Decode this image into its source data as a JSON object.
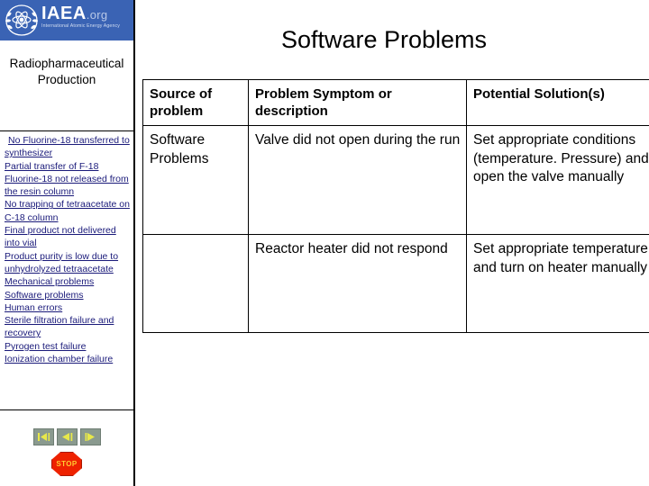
{
  "sidebar": {
    "logo": {
      "emblem_icon": "iaea-atom-laurel-icon",
      "main": "IAEA",
      "org": ".org",
      "subtitle": "International Atomic Energy Agency"
    },
    "title": "Radiopharmaceutical Production",
    "links": [
      "No Fluorine-18 transferred to synthesizer",
      "Partial transfer of F-18",
      "Fluorine-18 not released from the resin column",
      "No trapping of tetraacetate on C-18 column",
      "Final product not delivered into vial",
      "Product purity is low due to unhydrolyzed tetraacetate",
      "Mechanical problems",
      "Software problems",
      "Human errors",
      "Sterile filtration failure and recovery",
      "Pyrogen test failure",
      "Ionization chamber failure"
    ],
    "nav_buttons": [
      {
        "name": "first-slide-button",
        "icon": "first-slide-icon"
      },
      {
        "name": "previous-slide-button",
        "icon": "previous-slide-icon"
      },
      {
        "name": "next-slide-button",
        "icon": "next-slide-icon"
      }
    ],
    "stop_button": {
      "label": "STOP",
      "icon": "stop-octagon-icon"
    }
  },
  "main": {
    "title": "Software Problems",
    "table": {
      "headers": [
        "Source of problem",
        "Problem Symptom or description",
        "Potential Solution(s)"
      ],
      "rows": [
        {
          "source": "Software Problems",
          "symptom": "Valve did not open during the run",
          "solution": "Set appropriate conditions (temperature. Pressure) and open the valve manually"
        },
        {
          "source": "",
          "symptom": "Reactor heater did not respond",
          "solution": "Set appropriate temperature and turn on heater manually"
        }
      ]
    }
  },
  "colors": {
    "banner_blue": "#3a63b4",
    "link_navy": "#1a1a7a",
    "stop_red": "#ee2200",
    "stop_text": "#ffcc33",
    "nav_button_bg": "#8a9a8f"
  }
}
